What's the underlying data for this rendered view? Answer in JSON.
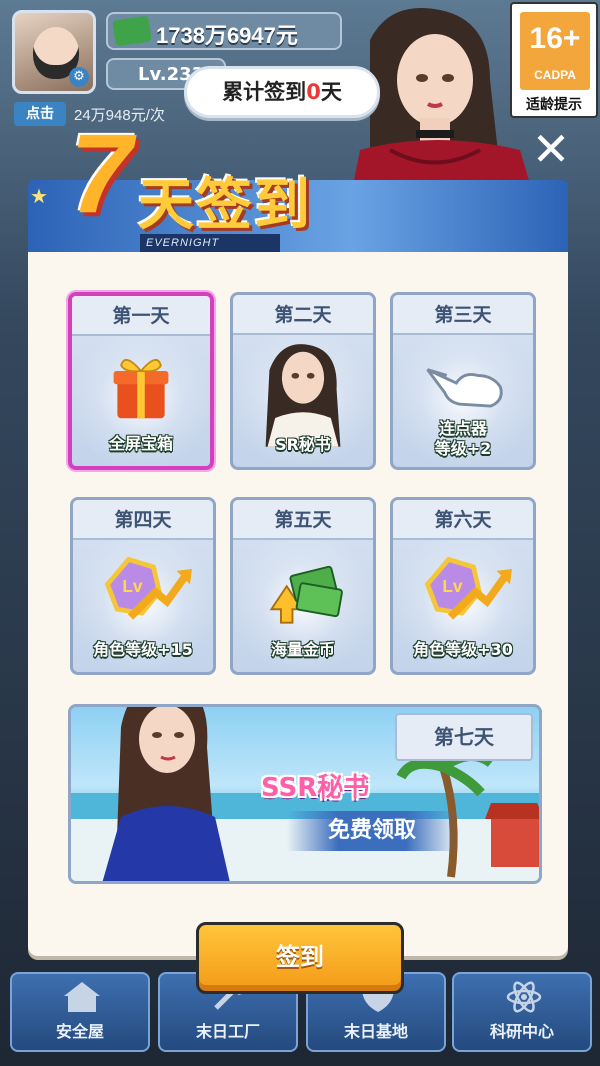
{
  "hud": {
    "money": "1738万6947元",
    "level": "Lv.233",
    "click_tag": "点击",
    "click_value": "24万948元/次"
  },
  "bubble": {
    "prefix": "累计签到",
    "count": "0",
    "suffix": "天"
  },
  "age_badge": {
    "rating": "16+",
    "org": "CADPA",
    "tip": "适龄提示"
  },
  "title": {
    "number": "7",
    "text": "天签到",
    "subtitle": "EVERNIGHT"
  },
  "days": [
    {
      "head": "第一天",
      "reward": "全屏宝箱",
      "icon": "gift-box-icon"
    },
    {
      "head": "第二天",
      "reward": "SR秘书",
      "icon": "secretary-portrait"
    },
    {
      "head": "第三天",
      "reward": "连点器\n等级+2",
      "icon": "tap-hand-icon"
    },
    {
      "head": "第四天",
      "reward": "角色等级+15",
      "icon": "level-up-icon"
    },
    {
      "head": "第五天",
      "reward": "海量金币",
      "icon": "cash-stack-icon"
    },
    {
      "head": "第六天",
      "reward": "角色等级+30",
      "icon": "level-up-icon"
    }
  ],
  "day7": {
    "head": "第七天",
    "reward": "SSR秘书",
    "subtext": "免费领取"
  },
  "sign_button": "签到",
  "bottom_nav": [
    "安全屋",
    "末日工厂",
    "末日基地",
    "科研中心"
  ],
  "colors": {
    "active_border": "#d43fbd",
    "button_orange": "#f39a18",
    "highlight_red": "#e83a3a"
  }
}
